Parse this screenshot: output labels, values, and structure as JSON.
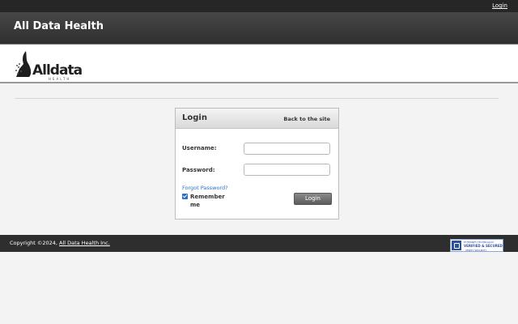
{
  "topbar": {
    "login_link": "Login"
  },
  "header": {
    "title": "All Data Health"
  },
  "logo": {
    "wordmark": "Alldata",
    "subline": "HEALTH"
  },
  "login_panel": {
    "title": "Login",
    "back_link": "Back to the site",
    "username_label": "Username:",
    "username_value": "",
    "password_label": "Password:",
    "password_value": "",
    "forgot_link": "Forgot Password?",
    "remember_label": "Remember me",
    "remember_checked": true,
    "login_button": "Login"
  },
  "footer": {
    "copyright": "Copyright ©2024, ",
    "company_link": "All Data Health Inc."
  },
  "seal": {
    "line1": "ETHERNET TECHNOLOGY",
    "line2": "VERIFIED & SECURED",
    "line3": "VERIFY SECURITY",
    "color": "#2c4f9e"
  },
  "colors": {
    "topbar": "#262626",
    "header": "#3a3a3a",
    "footer": "#2e2e2e",
    "link": "#2a6fc9",
    "background": "#f3f3f3"
  }
}
